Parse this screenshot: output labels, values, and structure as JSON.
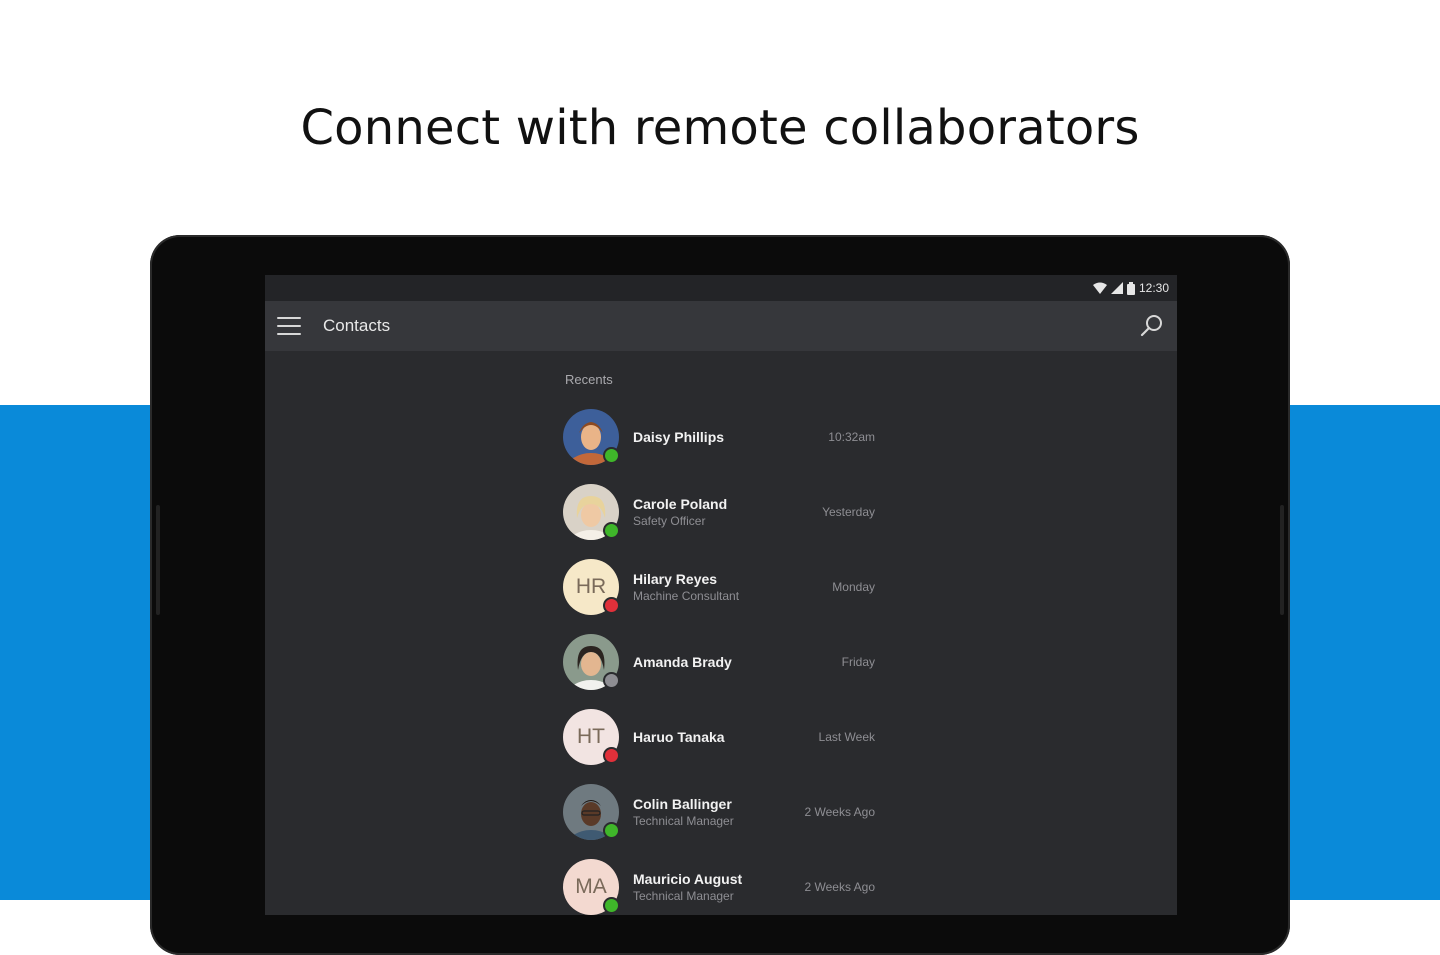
{
  "headline": "Connect with remote collaborators",
  "status_bar": {
    "time": "12:30",
    "icons": [
      "wifi-icon",
      "cellular-signal-icon",
      "battery-icon"
    ]
  },
  "app_bar": {
    "title": "Contacts",
    "menu_icon": "hamburger-menu-icon",
    "search_icon": "search-icon"
  },
  "section_label": "Recents",
  "colors": {
    "accent_blue": "#0a8ad9",
    "screen_bg": "#2a2b2e",
    "app_bar_bg": "#36373b",
    "presence_available": "#3fb62a",
    "presence_busy": "#e0303a",
    "presence_offline": "#8e8e93"
  },
  "contacts": [
    {
      "name": "Daisy Phillips",
      "role": "",
      "time": "10:32am",
      "avatar": "photo",
      "presence": "available"
    },
    {
      "name": "Carole Poland",
      "role": "Safety Officer",
      "time": "Yesterday",
      "avatar": "photo",
      "presence": "available"
    },
    {
      "name": "Hilary Reyes",
      "role": "Machine Consultant",
      "time": "Monday",
      "avatar": "initials",
      "initials": "HR",
      "presence": "busy"
    },
    {
      "name": "Amanda Brady",
      "role": "",
      "time": "Friday",
      "avatar": "photo",
      "presence": "offline"
    },
    {
      "name": "Haruo Tanaka",
      "role": "",
      "time": "Last Week",
      "avatar": "initials",
      "initials": "HT",
      "presence": "busy"
    },
    {
      "name": "Colin Ballinger",
      "role": "Technical Manager",
      "time": "2 Weeks Ago",
      "avatar": "photo",
      "presence": "available"
    },
    {
      "name": "Mauricio August",
      "role": "Technical Manager",
      "time": "2 Weeks Ago",
      "avatar": "initials",
      "initials": "MA",
      "presence": "available"
    }
  ]
}
